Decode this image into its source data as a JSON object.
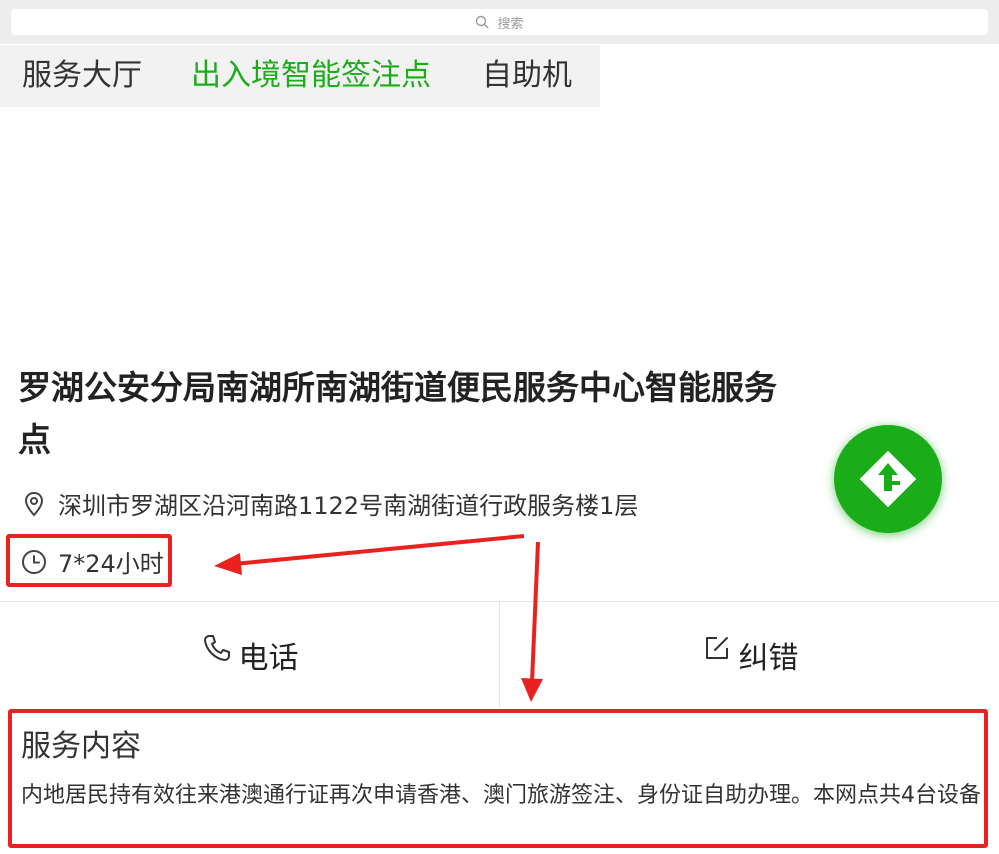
{
  "search": {
    "placeholder": "搜索"
  },
  "tabs": [
    {
      "label": "服务大厅",
      "active": false
    },
    {
      "label": "出入境智能签注点",
      "active": true
    },
    {
      "label": "自助机",
      "active": false
    }
  ],
  "place": {
    "name": "罗湖公安分局南湖所南湖街道便民服务中心智能服务点",
    "address": "深圳市罗湖区沿河南路1122号南湖街道行政服务楼1层",
    "hours": "7*24小时"
  },
  "actions": {
    "call_label": "电话",
    "correct_label": "纠错"
  },
  "service": {
    "title": "服务内容",
    "description": "内地居民持有效往来港澳通行证再次申请香港、澳门旅游签注、身份证自助办理。本网点共4台设备"
  },
  "colors": {
    "accent": "#1aad19",
    "annotation": "#e8231f"
  },
  "icons": {
    "search": "search-icon",
    "location": "location-pin-icon",
    "clock": "clock-icon",
    "phone": "phone-icon",
    "edit": "edit-icon",
    "navigate": "navigate-icon"
  }
}
